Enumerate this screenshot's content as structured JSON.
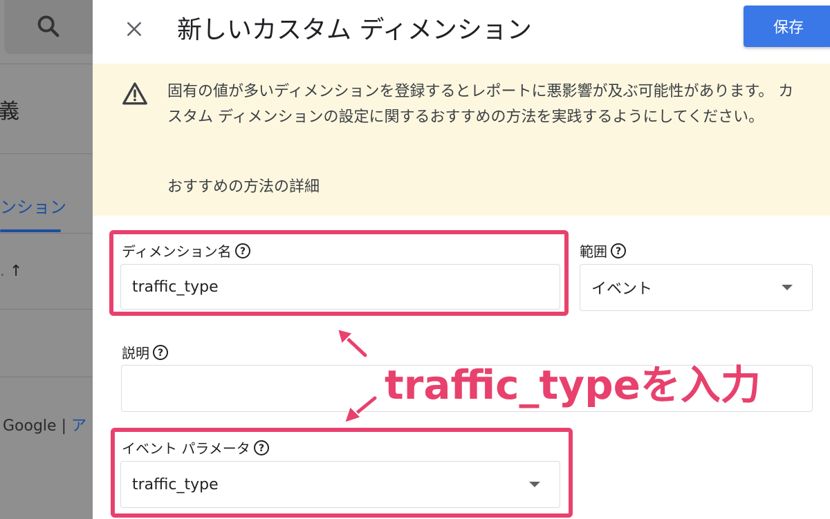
{
  "background": {
    "sort_arrow": "↑",
    "title_fragment": "義",
    "tab_fragment": "ンション",
    "footer_prefix": "Google | ",
    "footer_link": "ア"
  },
  "panel": {
    "title": "新しいカスタム ディメンション",
    "save_label": "保存",
    "close_icon": "close-icon"
  },
  "warning": {
    "text": "固有の値が多いディメンションを登録するとレポートに悪影響が及ぶ可能性があります。 カスタム ディメンションの設定に関するおすすめの方法を実践するようにしてください。",
    "link": "おすすめの方法の詳細"
  },
  "form": {
    "dimension_name_label": "ディメンション名",
    "dimension_name_value": "traffic_type",
    "scope_label": "範囲",
    "scope_value": "イベント",
    "description_label": "説明",
    "description_value": "",
    "event_param_label": "イベント パラメータ",
    "event_param_value": "traffic_type"
  },
  "annotation": {
    "text": "traffic_typeを入力",
    "color": "#e8416d"
  },
  "colors": {
    "accent": "#3b78e7",
    "warning_bg": "#fef7e0",
    "highlight": "#e8416d"
  }
}
